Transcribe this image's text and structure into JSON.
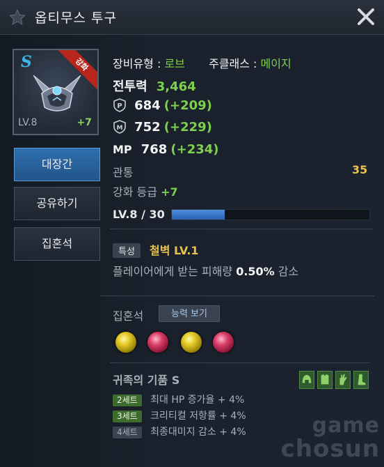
{
  "window": {
    "title": "옵티무스 투구"
  },
  "item": {
    "grade": "S",
    "ribbon": "강화",
    "level": "LV.8",
    "enhance": "+7"
  },
  "side_buttons": {
    "equip": "대장간",
    "share": "공유하기",
    "soulstone": "집혼석"
  },
  "info": {
    "equip_type_label": "장비유형 :",
    "equip_type_value": "로브",
    "class_label": "주클래스 :",
    "class_value": "메이지",
    "combat_label": "전투력",
    "combat_value": "3,464",
    "patk_value": "684",
    "patk_bonus": "(+209)",
    "matk_value": "752",
    "matk_bonus": "(+229)",
    "mp_label": "MP",
    "mp_value": "768",
    "mp_bonus": "(+234)",
    "pierce_label": "관통",
    "pierce_value": "35",
    "enhance_label": "강화 등급",
    "enhance_value": "+7"
  },
  "level_bar": {
    "label": "LV.8 / 30",
    "current": 8,
    "max": 30
  },
  "trait": {
    "badge": "특성",
    "name": "철벽 LV.1",
    "desc_prefix": "플레이어에게 받는 피해량",
    "desc_value": "0.50%",
    "desc_suffix": "감소"
  },
  "soulstones": {
    "label": "집혼석",
    "view_button": "능력 보기",
    "gems": [
      "yellow",
      "red",
      "yellow",
      "red"
    ]
  },
  "set": {
    "title": "귀족의 기품 S",
    "bonuses": [
      {
        "badge": "2세트",
        "text": "최대 HP 증가율 + 4%",
        "active": true
      },
      {
        "badge": "3세트",
        "text": "크리티컬 저항률 + 4%",
        "active": true
      },
      {
        "badge": "4세트",
        "text": "최종대미지 감소 + 4%",
        "active": false
      }
    ],
    "icons": [
      "helmet-icon",
      "armor-icon",
      "glove-icon",
      "boot-icon"
    ]
  },
  "watermark": {
    "line1": "game",
    "line2": "chosun"
  },
  "colors": {
    "accent_green": "#7ed04e",
    "accent_gold": "#e9c24c",
    "primary_button": "#2f6fae"
  }
}
